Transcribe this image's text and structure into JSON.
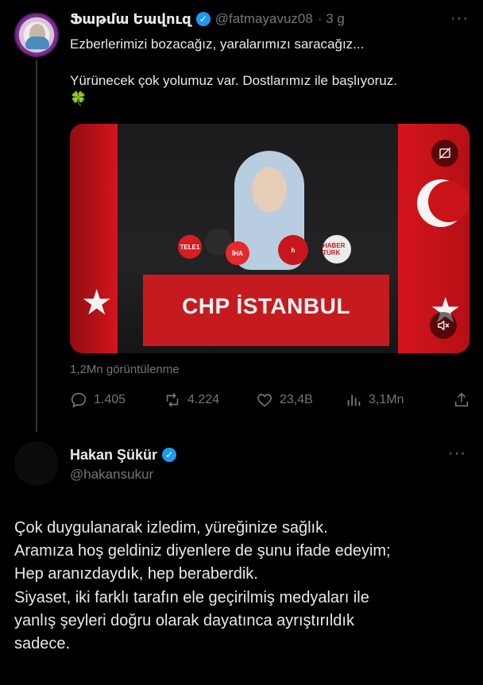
{
  "tweet1": {
    "display_name": "Ֆաթմա Եավուզ",
    "handle": "@fatmayavuz08",
    "time": "· 3 g",
    "text_line1": "Ezberlerimizi bozacağız, yaralarımızı saracağız...",
    "text_line2": "Yürünecek çok yolumuz var. Dostlarımız ile başlıyoruz. 🍀",
    "video": {
      "podium_text": "CHP İSTANBUL",
      "mic_labels": [
        "TELE1",
        "",
        "İHA",
        "h",
        "HABER TÜRK"
      ]
    },
    "views": "1,2Mn görüntülenme",
    "stats": {
      "replies": "1.405",
      "reposts": "4.224",
      "likes": "23,4B",
      "views": "3,1Mn"
    },
    "more": "···"
  },
  "tweet2": {
    "display_name": "Hakan Şükür",
    "handle": "@hakansukur",
    "more": "···",
    "lines": [
      "Çok duygulanarak izledim, yüreğinize sağlık.",
      "Aramıza hoş geldiniz diyenlere de şunu ifade edeyim;",
      "Hep aranızdaydık, hep beraberdik.",
      "Siyaset, iki farklı tarafın ele geçirilmiş medyaları ile",
      "yanlış şeyleri doğru olarak dayatınca ayrıştırıldık",
      "sadece."
    ]
  },
  "colors": {
    "background": "#000000",
    "text": "#e7e9ea",
    "muted": "#71767b",
    "verified": "#1d9bf0",
    "podium": "#c51b1f"
  }
}
